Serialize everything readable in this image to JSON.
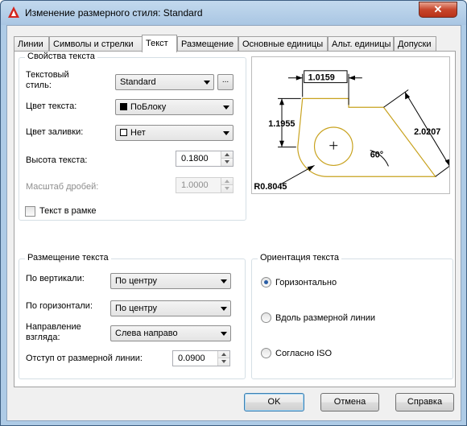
{
  "window": {
    "title": "Изменение размерного стиля: Standard",
    "close_glyph": "✕",
    "icon": "autocad-logo-icon"
  },
  "tabs": [
    {
      "label": "Линии",
      "active": false
    },
    {
      "label": "Символы и стрелки",
      "active": false
    },
    {
      "label": "Текст",
      "active": true
    },
    {
      "label": "Размещение",
      "active": false
    },
    {
      "label": "Основные единицы",
      "active": false
    },
    {
      "label": "Альт. единицы",
      "active": false
    },
    {
      "label": "Допуски",
      "active": false
    }
  ],
  "text_props": {
    "title": "Свойства текста",
    "style_label": "Текстовый\nстиль:",
    "style_value": "Standard",
    "style_browse": "...",
    "color_label": "Цвет текста:",
    "color_value": "ПоБлоку",
    "color_swatch": "#000000",
    "fill_label": "Цвет заливки:",
    "fill_value": "Нет",
    "fill_swatch": "#ffffff",
    "height_label": "Высота текста:",
    "height_value": "0.1800",
    "fraction_label": "Масштаб дробей:",
    "fraction_value": "1.0000",
    "frame_label": "Текст в рамке",
    "frame_checked": false
  },
  "placement": {
    "title": "Размещение текста",
    "vertical_label": "По вертикали:",
    "vertical_value": "По центру",
    "horizontal_label": "По горизонтали:",
    "horizontal_value": "По центру",
    "direction_label": "Направление\nвзгляда:",
    "direction_value": "Слева направо",
    "offset_label": "Отступ от размерной линии:",
    "offset_value": "0.0900"
  },
  "orientation": {
    "title": "Ориентация текста",
    "options": [
      {
        "label": "Горизонтально",
        "checked": true
      },
      {
        "label": "Вдоль размерной линии",
        "checked": false
      },
      {
        "label": "Согласно ISO",
        "checked": false
      }
    ]
  },
  "preview": {
    "dim_top": "1.0159",
    "dim_left": "1.1955",
    "dim_right": "2.0207",
    "dim_angle": "60°",
    "dim_radius": "R0.8045",
    "outline_color": "#c8a21e"
  },
  "buttons": {
    "ok": "OK",
    "cancel": "Отмена",
    "help": "Справка"
  }
}
